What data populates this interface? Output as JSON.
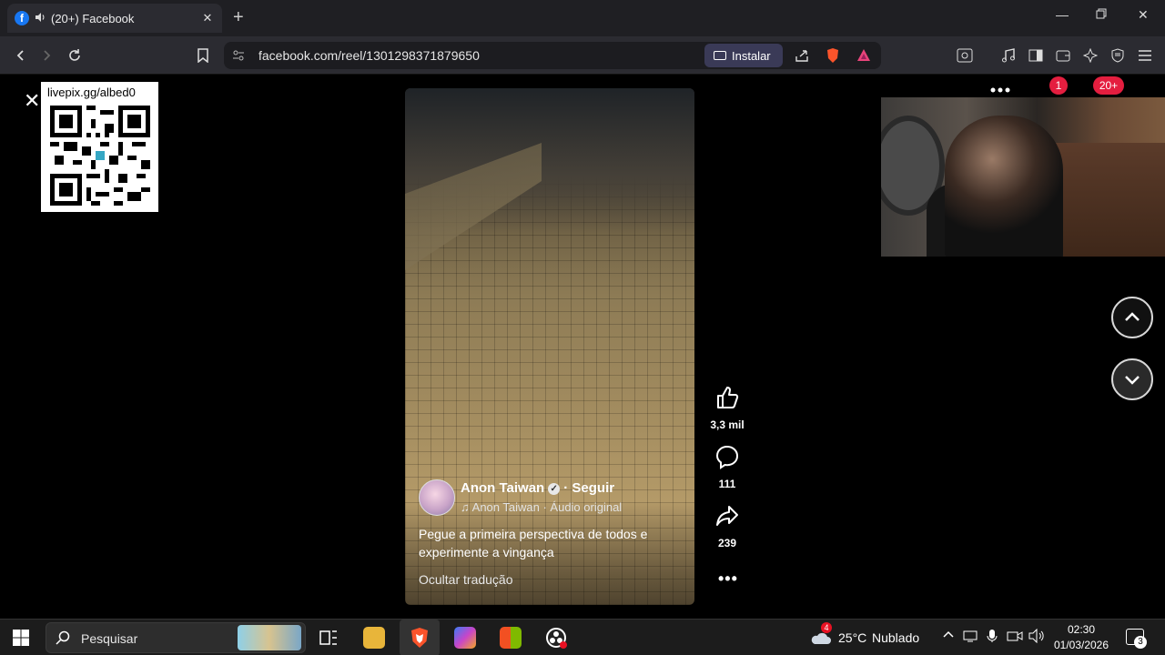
{
  "browser": {
    "tab": {
      "title": "(20+) Facebook",
      "favicon": "f"
    },
    "url": "facebook.com/reel/1301298371879650",
    "install_label": "Instalar",
    "accent": "#3a3a57"
  },
  "overlay": {
    "qr_label": "livepix.gg/albed0"
  },
  "reel": {
    "author": "Anon Taiwan",
    "follow_label": "Seguir",
    "audio": "Anon Taiwan · Áudio original",
    "caption": "Pegue a primeira perspectiva de todos e experimente a vingança",
    "hide_translation": "Ocultar tradução",
    "likes": "3,3 mil",
    "comments": "111",
    "shares": "239"
  },
  "header_badges": {
    "messages": "1",
    "notifications": "20+"
  },
  "taskbar": {
    "search_placeholder": "Pesquisar",
    "weather_temp": "25°C",
    "weather_text": "Nublado",
    "weather_badge": "4",
    "time": "02:30",
    "date": "01/03/2026",
    "notif_count": "3"
  }
}
